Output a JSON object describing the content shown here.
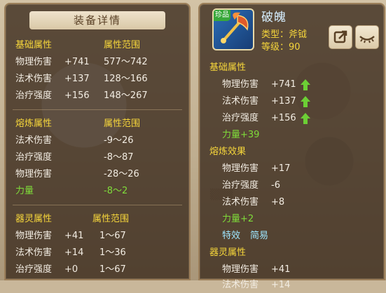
{
  "detail_panel": {
    "title": "装备详情",
    "sections": [
      {
        "header": "基础属性",
        "range_header": "属性范围",
        "rows": [
          {
            "name": "物理伤害",
            "value": "+741",
            "range": "577～742"
          },
          {
            "name": "法术伤害",
            "value": "+137",
            "range": "128～166"
          },
          {
            "name": "治疗强度",
            "value": "+156",
            "range": "148～267"
          }
        ]
      },
      {
        "header": "熔炼属性",
        "range_header": "属性范围",
        "rows": [
          {
            "name": "法术伤害",
            "value": "",
            "range": "-9～26"
          },
          {
            "name": "治疗强度",
            "value": "",
            "range": "-8～87"
          },
          {
            "name": "物理伤害",
            "value": "",
            "range": "-28～26"
          },
          {
            "name": "力量",
            "value": "",
            "range": "-8～2",
            "highlight": true
          }
        ]
      },
      {
        "header": "器灵属性",
        "range_header": "属性范围",
        "rows": [
          {
            "name": "物理伤害",
            "value": "+41",
            "range": "1～67"
          },
          {
            "name": "法术伤害",
            "value": "+14",
            "range": "1～36"
          },
          {
            "name": "治疗强度",
            "value": "+0",
            "range": "1～67"
          }
        ]
      }
    ]
  },
  "item_panel": {
    "badge": "珍品",
    "name": "破魄",
    "type_label": "类型：斧钺",
    "level_label": "等级：90",
    "icons": {
      "share": "share-icon",
      "eye": "eye-icon",
      "up": "up-arrow-icon"
    },
    "base": {
      "header": "基础属性",
      "rows": [
        {
          "name": "物理伤害",
          "value": "+741"
        },
        {
          "name": "法术伤害",
          "value": "+137"
        },
        {
          "name": "治疗强度",
          "value": "+156"
        }
      ],
      "bonus": "力量+39"
    },
    "smelt": {
      "header": "熔炼效果",
      "rows": [
        {
          "name": "物理伤害",
          "value": "+17"
        },
        {
          "name": "治疗强度",
          "value": "-6"
        },
        {
          "name": "法术伤害",
          "value": "+8"
        }
      ],
      "bonus": "力量+2"
    },
    "special_label": "特效",
    "special_value": "简易",
    "spirit": {
      "header": "器灵属性",
      "rows": [
        {
          "name": "物理伤害",
          "value": "+41"
        },
        {
          "name": "法术伤害",
          "value": "+14"
        }
      ]
    }
  },
  "colors": {
    "yellow": "#f6d63b",
    "green": "#7fdc3a",
    "panel": "#3c2c1e"
  }
}
